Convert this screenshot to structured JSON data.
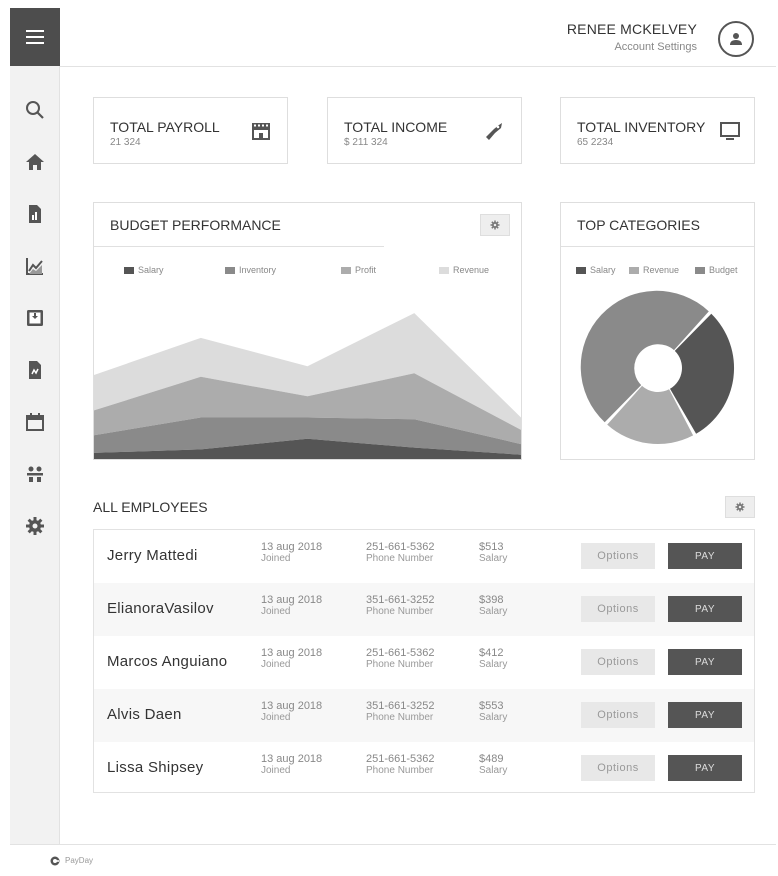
{
  "header": {
    "user_name": "RENEE MCKELVEY",
    "account_link": "Account Settings"
  },
  "sidebar": {
    "icons": [
      "menu-icon",
      "search-icon",
      "home-icon",
      "report-icon",
      "analytics-icon",
      "inbox-icon",
      "document-icon",
      "calendar-icon",
      "team-icon",
      "gear-icon"
    ]
  },
  "stats": [
    {
      "title": "TOTAL PAYROLL",
      "value": "21 324",
      "icon": "store-icon"
    },
    {
      "title": "TOTAL INCOME",
      "value": "$ 211 324",
      "icon": "tag-icon"
    },
    {
      "title": "TOTAL INVENTORY",
      "value": "65 2234",
      "icon": "monitor-icon"
    }
  ],
  "budget": {
    "title": "BUDGET PERFORMANCE"
  },
  "categories": {
    "title": "TOP CATEGORIES"
  },
  "colors": {
    "salary": "#555555",
    "inventory": "#8a8a8a",
    "profit": "#acacac",
    "revenue": "#dcdcdc",
    "pay_button": "#555555",
    "sidebar_active": "#4d4d4d"
  },
  "chart_data": [
    {
      "type": "area",
      "stacked": true,
      "x": [
        0,
        1,
        2,
        3,
        4
      ],
      "ylim": [
        0,
        100
      ],
      "grid": false,
      "legend": "top",
      "series": [
        {
          "name": "Salary",
          "values": [
            4,
            6,
            12,
            7,
            3
          ]
        },
        {
          "name": "Inventory",
          "values": [
            10,
            18,
            12,
            16,
            6
          ]
        },
        {
          "name": "Profit",
          "values": [
            14,
            23,
            12,
            26,
            8
          ]
        },
        {
          "name": "Revenue",
          "values": [
            20,
            22,
            17,
            34,
            7
          ]
        }
      ]
    },
    {
      "type": "pie",
      "donut": true,
      "legend": "top",
      "categories": [
        "Salary",
        "Revenue",
        "Budget"
      ],
      "values": [
        30,
        20,
        50
      ]
    }
  ],
  "employees": {
    "title": "ALL EMPLOYEES",
    "joined_label": "Joined",
    "phone_label": "Phone Number",
    "salary_label": "Salary",
    "options_label": "Options",
    "pay_label": "PAY",
    "rows": [
      {
        "name": "Jerry Mattedi",
        "date": "13 aug 2018",
        "phone": "251-661-5362",
        "salary": "$513"
      },
      {
        "name": "ElianoraVasilov",
        "date": "13 aug 2018",
        "phone": "351-661-3252",
        "salary": "$398"
      },
      {
        "name": "Marcos Anguiano",
        "date": "13 aug 2018",
        "phone": "251-661-5362",
        "salary": "$412"
      },
      {
        "name": "Alvis Daen",
        "date": "13 aug 2018",
        "phone": "351-661-3252",
        "salary": "$553"
      },
      {
        "name": "Lissa Shipsey",
        "date": "13 aug 2018",
        "phone": "251-661-5362",
        "salary": "$489"
      }
    ]
  },
  "footer": {
    "brand": "PayDay"
  }
}
